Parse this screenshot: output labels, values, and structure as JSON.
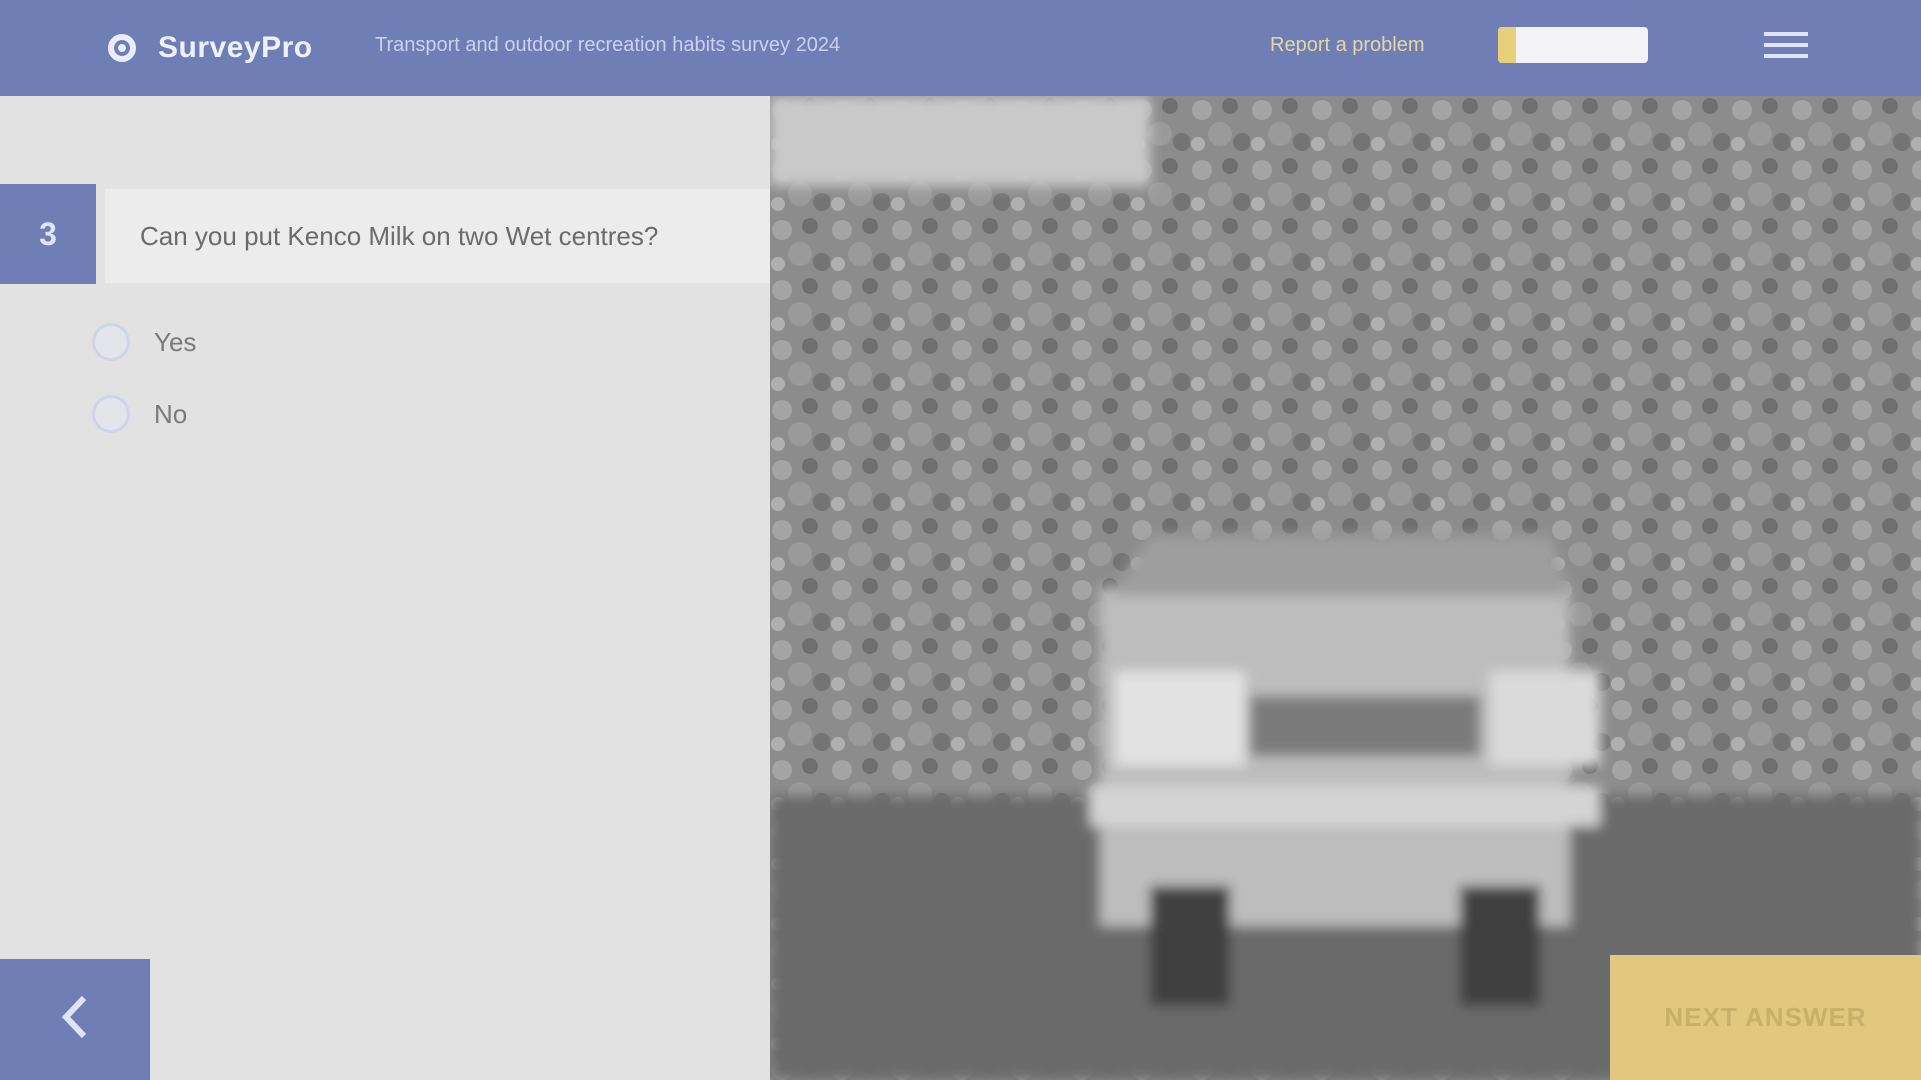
{
  "header": {
    "logo_text": "SurveyPro",
    "survey_title": "Transport and outdoor recreation habits survey 2024",
    "report_link": "Report a problem",
    "progress_percent": 12
  },
  "question": {
    "number": "3",
    "text": "Can you put Kenco Milk on two Wet centres?",
    "options": [
      {
        "label": "Yes"
      },
      {
        "label": "No"
      }
    ]
  },
  "navigation": {
    "next_label": "NEXT ANSWER"
  },
  "colors": {
    "accent": "#6f7fb5",
    "next": "#e2c77e",
    "panel": "#e2e2e2"
  }
}
